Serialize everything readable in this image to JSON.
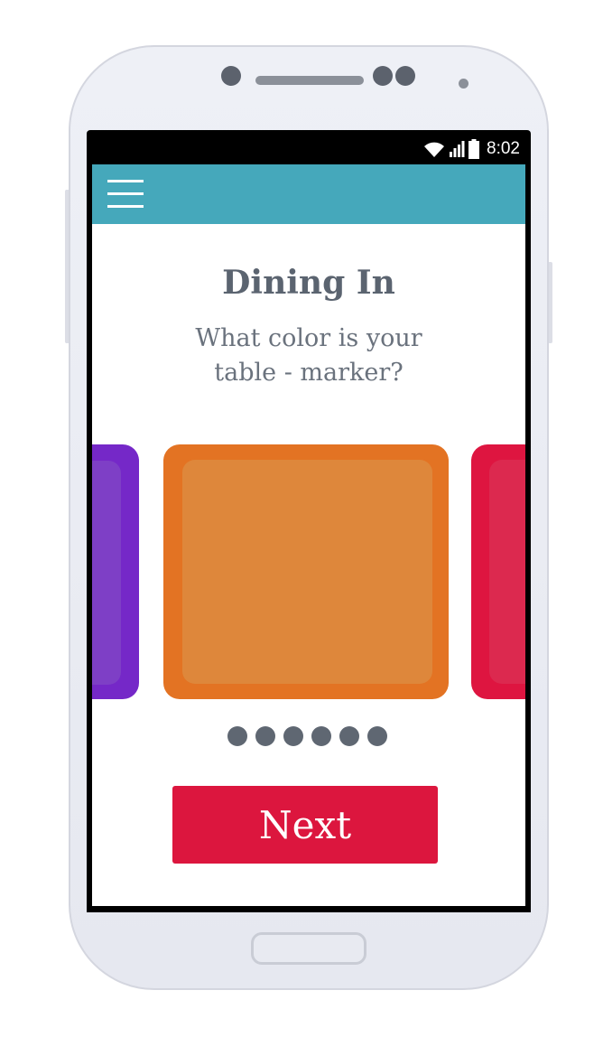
{
  "status_bar": {
    "time": "8:02",
    "icons": [
      "wifi-icon",
      "signal-icon",
      "battery-icon"
    ]
  },
  "app_bar": {
    "color": "#45a8bb",
    "menu_icon": "hamburger-menu-icon"
  },
  "page": {
    "title": "Dining In",
    "subtitle": "What color is your table - marker?"
  },
  "colors": {
    "cards": [
      {
        "name": "purple",
        "outer": "#7528c8",
        "inner": "#7e3fc6"
      },
      {
        "name": "orange",
        "outer": "#e37323",
        "inner": "#de873b"
      },
      {
        "name": "red",
        "outer": "#de1540",
        "inner": "#dc294f"
      }
    ],
    "selected": "orange"
  },
  "pager": {
    "count": 6,
    "color": "#5f6772"
  },
  "next_button": {
    "label": "Next",
    "color": "#dc163e"
  }
}
